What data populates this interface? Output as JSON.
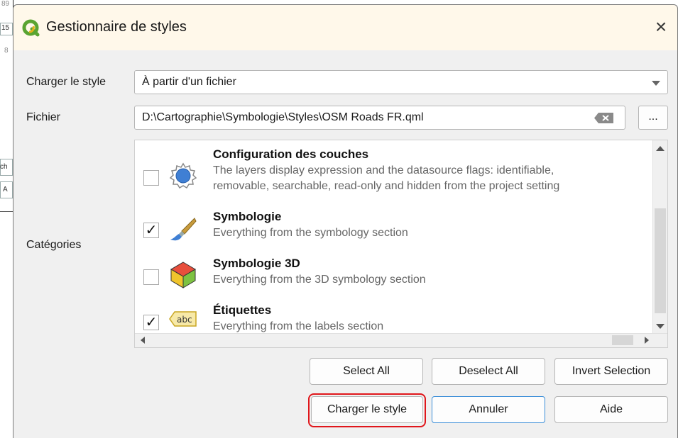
{
  "background": {
    "fragments": [
      "89",
      "15",
      "8",
      "ch",
      "A"
    ]
  },
  "dialog": {
    "title": "Gestionnaire de styles",
    "close_label": "×",
    "load_style": {
      "label": "Charger le style",
      "selected": "À partir d'un fichier"
    },
    "file": {
      "label": "Fichier",
      "value": "D:\\Cartographie\\Symbologie\\Styles\\OSM Roads FR.qml",
      "browse_label": "..."
    },
    "categories": {
      "label": "Catégories",
      "items": [
        {
          "title": "Configuration des couches",
          "desc1": "The layers display expression and the datasource flags: identifiable,",
          "desc2": "removable, searchable, read-only and hidden from the project setting",
          "checked": false,
          "icon": "gear-icon"
        },
        {
          "title": "Symbologie",
          "desc1": "Everything from the symbology section",
          "checked": true,
          "icon": "paintbrush-icon"
        },
        {
          "title": "Symbologie 3D",
          "desc1": "Everything from the 3D symbology section",
          "checked": false,
          "icon": "cube-icon"
        },
        {
          "title": "Étiquettes",
          "desc1": "Everything from the labels section",
          "checked": true,
          "icon": "abc-label-icon"
        }
      ]
    },
    "buttons": {
      "select_all": "Select All",
      "deselect_all": "Deselect All",
      "invert_selection": "Invert Selection",
      "load": "Charger le style",
      "cancel": "Annuler",
      "help": "Aide"
    },
    "colors": {
      "accent": "#3b8ed8",
      "highlight": "#e0161b",
      "qgis_green": "#5aa431"
    }
  }
}
